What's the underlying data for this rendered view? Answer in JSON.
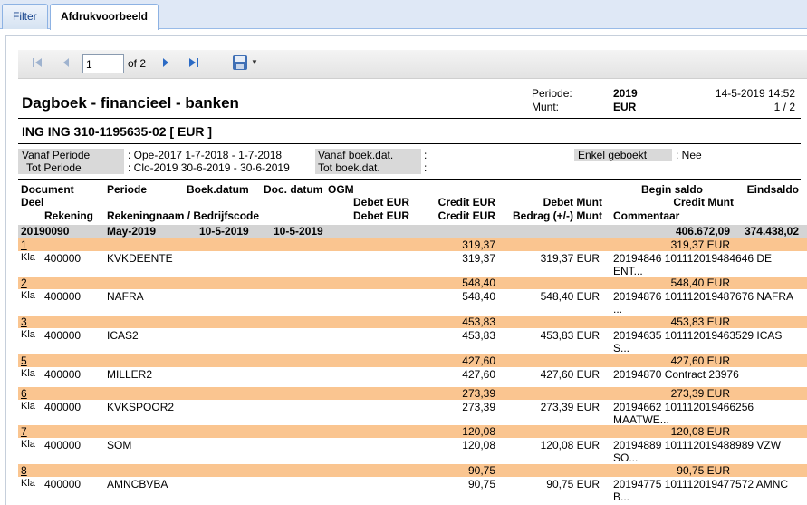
{
  "tabs": [
    {
      "label": "Filter"
    },
    {
      "label": "Afdrukvoorbeeld"
    }
  ],
  "toolbar": {
    "page_value": "1",
    "of_label": "of 2"
  },
  "report": {
    "title": "Dagboek - financieel - banken",
    "periode_label": "Periode:",
    "periode_value": "2019",
    "munt_label": "Munt:",
    "munt_value": "EUR",
    "datetime": "14-5-2019 14:52",
    "pages": "1 / 2",
    "account": "ING ING  310-1195635-02 [ EUR ]",
    "filters": {
      "vanaf_periode_label": "Vanaf Periode",
      "vanaf_periode_value": ": Ope-2017 1-7-2018 - 1-7-2018",
      "tot_periode_label": "Tot Periode",
      "tot_periode_value": ": Clo-2019 30-6-2019 - 30-6-2019",
      "vanaf_boek_label": "Vanaf boek.dat.",
      "vanaf_boek_value": ":",
      "tot_boek_label": "Tot boek.dat.",
      "tot_boek_value": ":",
      "enkel_label": "Enkel geboekt",
      "enkel_value": ": Nee"
    },
    "headers": {
      "document": "Document",
      "periode": "Periode",
      "boekdatum": "Boek.datum",
      "docdatum": "Doc. datum",
      "ogm": "OGM",
      "beginsaldo": "Begin saldo",
      "eindsaldo": "Eindsaldo",
      "deel": "Deel",
      "debet1": "Debet EUR",
      "credit1": "Credit EUR",
      "debetmunt": "Debet Munt",
      "creditmunt": "Credit Munt",
      "rekening": "Rekening",
      "rekeningnaam": "Rekeningnaam / Bedrijfscode",
      "debet2": "Debet EUR",
      "credit2": "Credit EUR",
      "bedrag": "Bedrag (+/-) Munt",
      "commentaar": "Commentaar"
    },
    "summary": {
      "document": "20190090",
      "periode": "May-2019",
      "boekdatum": "10-5-2019",
      "docdatum": "10-5-2019",
      "beginsaldo": "406.672,09",
      "eindsaldo": "374.438,02"
    },
    "lines": [
      {
        "deel": "1",
        "credit": "319,37",
        "creditmunt": "319,37 EUR",
        "type": "Kla",
        "rek": "400000",
        "naam": "KVKDEENTE",
        "credit2": "319,37",
        "bedrag": "319,37 EUR",
        "comm1": "20194846 101112019484646 DE",
        "comm2": "ENT..."
      },
      {
        "deel": "2",
        "credit": "548,40",
        "creditmunt": "548,40 EUR",
        "type": "Kla",
        "rek": "400000",
        "naam": "NAFRA",
        "credit2": "548,40",
        "bedrag": "548,40 EUR",
        "comm1": "20194876 101112019487676 NAFRA",
        "comm2": "..."
      },
      {
        "deel": "3",
        "credit": "453,83",
        "creditmunt": "453,83 EUR",
        "type": "Kla",
        "rek": "400000",
        "naam": "ICAS2",
        "credit2": "453,83",
        "bedrag": "453,83 EUR",
        "comm1": "20194635 101112019463529 ICAS",
        "comm2": "S..."
      },
      {
        "deel": "5",
        "credit": "427,60",
        "creditmunt": "427,60 EUR",
        "type": "Kla",
        "rek": "400000",
        "naam": "MILLER2",
        "credit2": "427,60",
        "bedrag": "427,60 EUR",
        "comm1": "20194870 Contract 23976",
        "comm2": ""
      },
      {
        "deel": "6",
        "credit": "273,39",
        "creditmunt": "273,39 EUR",
        "type": "Kla",
        "rek": "400000",
        "naam": "KVKSPOOR2",
        "credit2": "273,39",
        "bedrag": "273,39 EUR",
        "comm1": "20194662 101112019466256",
        "comm2": "MAATWE..."
      },
      {
        "deel": "7",
        "credit": "120,08",
        "creditmunt": "120,08 EUR",
        "type": "Kla",
        "rek": "400000",
        "naam": "SOM",
        "credit2": "120,08",
        "bedrag": "120,08 EUR",
        "comm1": "20194889 101112019488989 VZW",
        "comm2": "SO..."
      },
      {
        "deel": "8",
        "credit": "90,75",
        "creditmunt": "90,75 EUR",
        "type": "Kla",
        "rek": "400000",
        "naam": "AMNCBVBA",
        "credit2": "90,75",
        "bedrag": "90,75 EUR",
        "comm1": "20194775 101112019477572 AMNC",
        "comm2": "B..."
      }
    ]
  }
}
